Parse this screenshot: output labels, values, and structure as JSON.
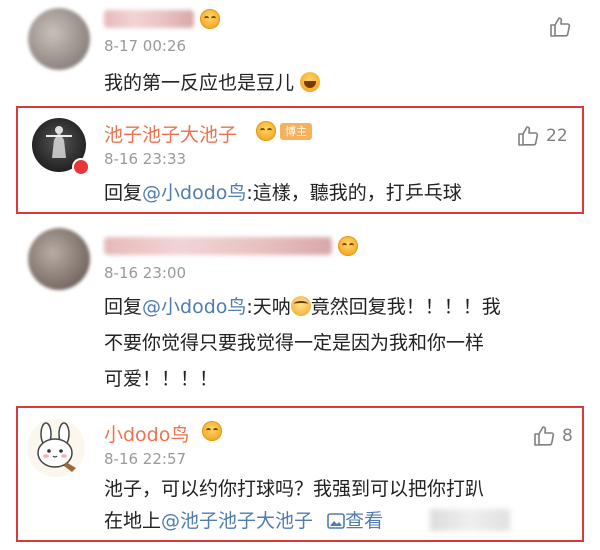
{
  "comments": [
    {
      "timestamp": "8-17 00:26",
      "text": "我的第一反应也是豆儿"
    },
    {
      "username": "池子池子大池子",
      "badge": "博主",
      "timestamp": "8-16 23:33",
      "reply_prefix": "回复",
      "mention": "@小dodo鸟",
      "text": ":這樣，聽我的，打乒乓球",
      "likes": "22"
    },
    {
      "timestamp": "8-16 23:00",
      "reply_prefix": "回复",
      "mention": "@小dodo鸟",
      "line1_a": ":天呐",
      "line1_b": "竟然回复我！！！！我",
      "line2": "不要你觉得只要我觉得一定是因为我和你一样",
      "line3": "可爱！！！！"
    },
    {
      "username": "小dodo鸟",
      "timestamp": "8-16 22:57",
      "line1": "池子，可以约你打球吗？我强到可以把你打趴",
      "line2_a": "在地上",
      "mention": "@池子池子大池子",
      "line2_b": "查看",
      "likes": "8"
    }
  ],
  "colors": {
    "username": "#eb7350",
    "mention": "#507daf",
    "highlight": "#d73a3a"
  }
}
